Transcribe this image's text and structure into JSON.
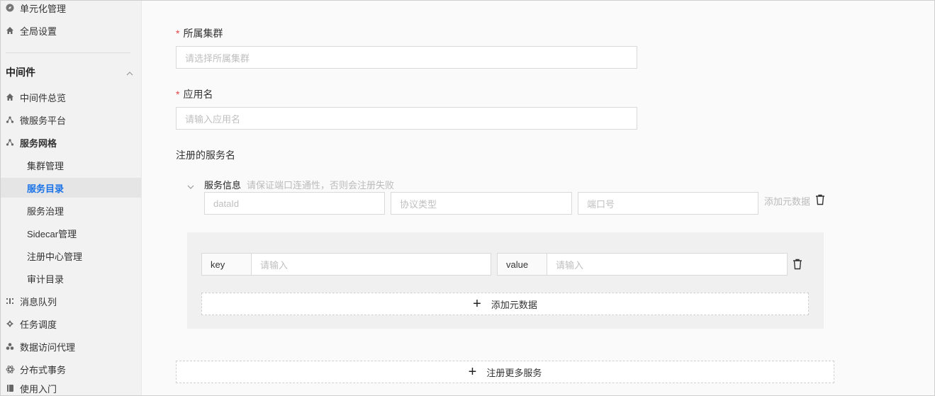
{
  "sidebar": {
    "top_items": [
      {
        "label": "单元化管理",
        "icon": "compass-icon"
      },
      {
        "label": "全局设置",
        "icon": "home-icon"
      }
    ],
    "group": {
      "title": "中间件",
      "chevron": "chevron-up-icon"
    },
    "items": [
      {
        "label": "中间件总览",
        "icon": "home-icon"
      },
      {
        "label": "微服务平台",
        "icon": "network-icon"
      },
      {
        "label": "服务网格",
        "icon": "network-icon"
      }
    ],
    "sub_items": [
      {
        "label": "集群管理"
      },
      {
        "label": "服务目录",
        "active": true
      },
      {
        "label": "服务治理"
      },
      {
        "label": "Sidecar管理"
      },
      {
        "label": "注册中心管理"
      },
      {
        "label": "审计目录"
      }
    ],
    "more_items": [
      {
        "label": "消息队列",
        "icon": "queue-icon"
      },
      {
        "label": "任务调度",
        "icon": "schedule-icon"
      },
      {
        "label": "数据访问代理",
        "icon": "database-icon"
      },
      {
        "label": "分布式事务",
        "icon": "atom-icon"
      },
      {
        "label": "使用入门",
        "icon": "book-icon"
      }
    ]
  },
  "form": {
    "cluster": {
      "label": "所属集群",
      "required_mark": "*",
      "placeholder": "请选择所属集群"
    },
    "app": {
      "label": "应用名",
      "required_mark": "*",
      "placeholder": "请输入应用名"
    },
    "registered_service": {
      "label": "注册的服务名"
    },
    "service_info": {
      "title": "服务信息",
      "hint": "请保证端口连通性，否则会注册失败",
      "dataid_placeholder": "dataId",
      "protocol_placeholder": "协议类型",
      "port_placeholder": "端口号",
      "add_metadata_link": "添加元数据"
    },
    "metadata": {
      "key_label": "key",
      "key_placeholder": "请输入",
      "value_label": "value",
      "value_placeholder": "请输入",
      "add_button": "添加元数据"
    },
    "register_more_button": "注册更多服务"
  },
  "colors": {
    "accent": "#1a73e8",
    "required": "#e54545"
  }
}
